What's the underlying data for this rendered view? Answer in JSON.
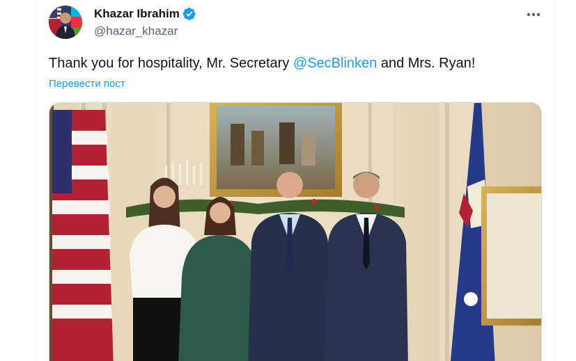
{
  "author": {
    "display_name": "Khazar Ibrahim",
    "handle": "@hazar_khazar",
    "verified": true
  },
  "tweet": {
    "text_before": "Thank you for hospitality, Mr. Secretary ",
    "mention": "@SecBlinken",
    "text_after": " and Mrs. Ryan!",
    "translate_label": "Перевести пост"
  },
  "colors": {
    "accent": "#1d9bf0",
    "text_primary": "#0f1419",
    "text_secondary": "#536471"
  },
  "icons": {
    "verified": "verified-badge-icon",
    "more": "more-dots-icon"
  },
  "media": {
    "type": "photo"
  }
}
